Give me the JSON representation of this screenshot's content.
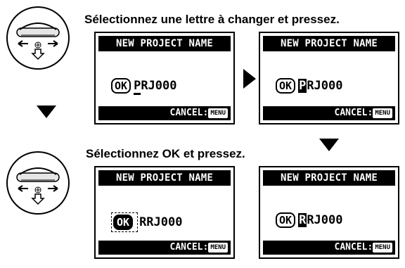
{
  "captions": {
    "top": "Sélectionnez une lettre à changer et pressez.",
    "middle": "Sélectionnez OK et pressez."
  },
  "screens": [
    {
      "title": "NEW PROJECT NAME",
      "ok_label": "OK",
      "name_prefix": "",
      "cursor_char": "P",
      "name_rest": "RJ000",
      "cancel_label": "CANCEL:",
      "menu_key": "MENU"
    },
    {
      "title": "NEW PROJECT NAME",
      "ok_label": "OK",
      "cursor_char": "P",
      "name_rest": "RJ000",
      "cancel_label": "CANCEL:",
      "menu_key": "MENU"
    },
    {
      "title": "NEW PROJECT NAME",
      "ok_label": "OK",
      "name_rest": "RRJ000",
      "cancel_label": "CANCEL:",
      "menu_key": "MENU"
    },
    {
      "title": "NEW PROJECT NAME",
      "ok_label": "OK",
      "cursor_char": "R",
      "name_rest": "RJ000",
      "cancel_label": "CANCEL:",
      "menu_key": "MENU"
    }
  ],
  "icons": {
    "dial": "jog-dial-icon",
    "next": "arrow-right-icon",
    "down": "arrow-down-icon"
  }
}
